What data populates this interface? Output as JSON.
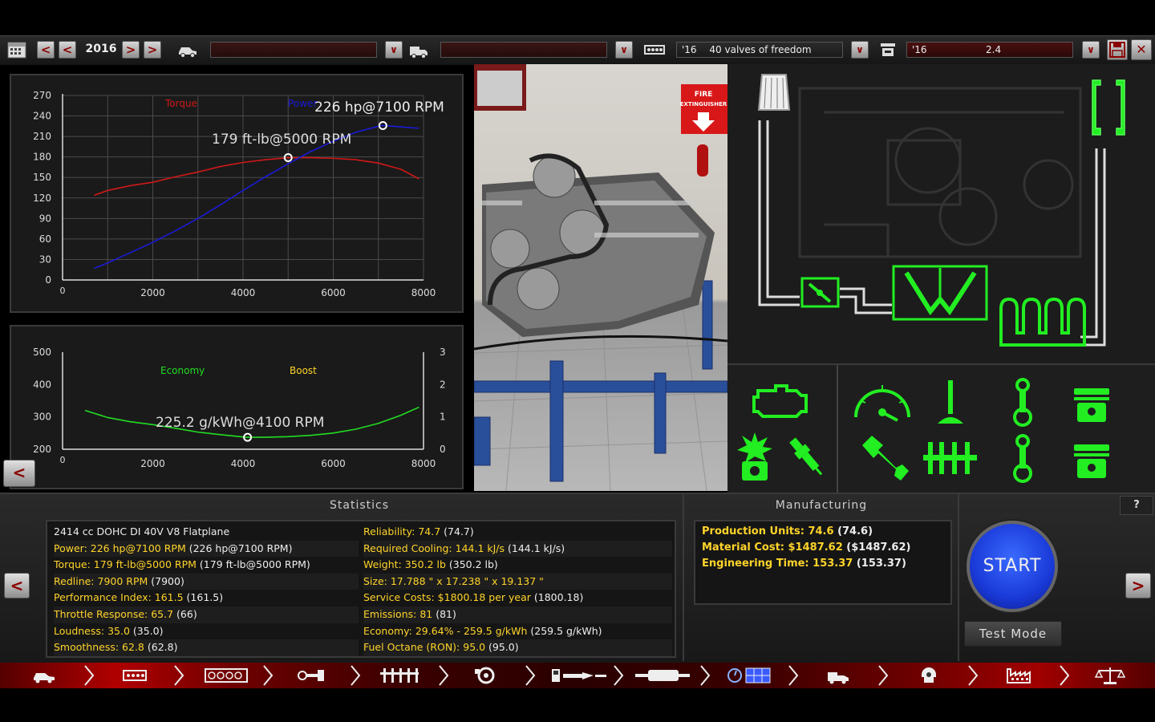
{
  "toolbar": {
    "year": "2016",
    "car_model": "",
    "car_trim": "",
    "engine_family_year": "'16",
    "engine_family_name": "40 valves of freedom",
    "engine_variant_year": "'16",
    "engine_variant_name": "2.4"
  },
  "torque_power_chart": {
    "torque_label": "Torque",
    "power_label": "Power",
    "power_peak": "226 hp@7100 RPM",
    "torque_peak": "179 ft-lb@5000 RPM"
  },
  "economy_chart": {
    "economy_label": "Economy",
    "boost_label": "Boost",
    "economy_peak": "225.2 g/kWh@4100 RPM"
  },
  "chart_data": [
    {
      "type": "line",
      "title": "",
      "xlabel": "",
      "ylabel": "",
      "xlim": [
        0,
        8000
      ],
      "ylim": [
        0,
        270
      ],
      "x_ticks": [
        "0",
        "2000",
        "4000",
        "6000",
        "8000"
      ],
      "y_ticks": [
        "0",
        "30",
        "60",
        "90",
        "120",
        "150",
        "180",
        "210",
        "240",
        "270"
      ],
      "grid": true,
      "series": [
        {
          "name": "Torque",
          "color": "#d01818",
          "x": [
            700,
            1000,
            1500,
            2000,
            2500,
            3000,
            3500,
            4000,
            4500,
            5000,
            5500,
            6000,
            6500,
            7000,
            7500,
            7900
          ],
          "y": [
            124,
            131,
            138,
            143,
            151,
            158,
            166,
            172,
            176,
            179,
            179,
            178,
            176,
            171,
            162,
            148
          ]
        },
        {
          "name": "Power",
          "color": "#1a1ad8",
          "x": [
            700,
            1000,
            1500,
            2000,
            2500,
            3000,
            3500,
            4000,
            4500,
            5000,
            5500,
            6000,
            6500,
            7000,
            7100,
            7500,
            7900
          ],
          "y": [
            17,
            25,
            40,
            55,
            72,
            90,
            110,
            131,
            151,
            170,
            188,
            203,
            216,
            225,
            226,
            224,
            222
          ]
        }
      ],
      "annotations": [
        {
          "text": "226 hp@7100 RPM",
          "x": 7100,
          "y": 226
        },
        {
          "text": "179 ft-lb@5000 RPM",
          "x": 5000,
          "y": 179
        }
      ]
    },
    {
      "type": "line",
      "title": "",
      "xlim": [
        0,
        8000
      ],
      "ylim": [
        200,
        500
      ],
      "y2lim": [
        0,
        3
      ],
      "x_ticks": [
        "0",
        "2000",
        "4000",
        "6000",
        "8000"
      ],
      "y_ticks": [
        "200",
        "300",
        "400",
        "500"
      ],
      "y2_ticks": [
        "0",
        "1",
        "2",
        "3"
      ],
      "grid": false,
      "series": [
        {
          "name": "Economy",
          "color": "#22dd22",
          "x": [
            500,
            1000,
            1500,
            2000,
            2500,
            3000,
            3500,
            4000,
            4100,
            4500,
            5000,
            5500,
            6000,
            6500,
            7000,
            7500,
            7900
          ],
          "y": [
            320,
            298,
            285,
            276,
            265,
            253,
            245,
            238,
            237,
            237,
            239,
            243,
            250,
            262,
            280,
            305,
            330
          ]
        }
      ],
      "annotations": [
        {
          "text": "225.2 g/kWh@4100 RPM",
          "x": 4100,
          "y": 237
        }
      ]
    }
  ],
  "statistics": {
    "title": "Statistics",
    "left": [
      {
        "label": "2414 cc DOHC DI 40V V8 Flatplane",
        "value": ""
      },
      {
        "label": "Power: 226 hp@7100 RPM",
        "value": " (226 hp@7100 RPM)"
      },
      {
        "label": "Torque: 179 ft-lb@5000 RPM",
        "value": " (179 ft-lb@5000 RPM)"
      },
      {
        "label": "Redline: 7900 RPM",
        "value": " (7900)"
      },
      {
        "label": "Performance Index: 161.5",
        "value": " (161.5)"
      },
      {
        "label": "Throttle Response: 65.7",
        "value": " (66)"
      },
      {
        "label": "Loudness: 35.0",
        "value": " (35.0)"
      },
      {
        "label": "Smoothness: 62.8",
        "value": " (62.8)"
      }
    ],
    "right": [
      {
        "label": "Reliability: 74.7",
        "value": " (74.7)"
      },
      {
        "label": "Required Cooling: 144.1 kJ/s",
        "value": " (144.1 kJ/s)"
      },
      {
        "label": "Weight: 350.2 lb",
        "value": " (350.2 lb)"
      },
      {
        "label": "Size: 17.788 \" x 17.238 \" x 19.137 \"",
        "value": ""
      },
      {
        "label": "Service Costs: $1800.18 per year",
        "value": " (1800.18)"
      },
      {
        "label": "Emissions: 81",
        "value": " (81)"
      },
      {
        "label": "Economy: 29.64% - 259.5 g/kWh",
        "value": " (259.5 g/kWh)"
      },
      {
        "label": "Fuel Octane (RON): 95.0",
        "value": " (95.0)"
      }
    ]
  },
  "manufacturing": {
    "title": "Manufacturing",
    "rows": [
      {
        "label": "Production Units: 74.6",
        "value": " (74.6)"
      },
      {
        "label": "Material Cost: $1487.62",
        "value": " ($1487.62)"
      },
      {
        "label": "Engineering Time: 153.37",
        "value": " (153.37)"
      }
    ]
  },
  "controls": {
    "start_label": "START",
    "test_mode_label": "Test Mode",
    "help_label": "?",
    "prev_label": "<",
    "next_label": ">",
    "year_prev_label": "<",
    "year_next_label": ">"
  },
  "viewport": {
    "fire_sign_line1": "FIRE",
    "fire_sign_line2": "EXTINGUISHER"
  },
  "colors": {
    "accent_green": "#22ff22",
    "stat_yellow": "#ffd42a",
    "start_blue": "#1a3ad8"
  }
}
